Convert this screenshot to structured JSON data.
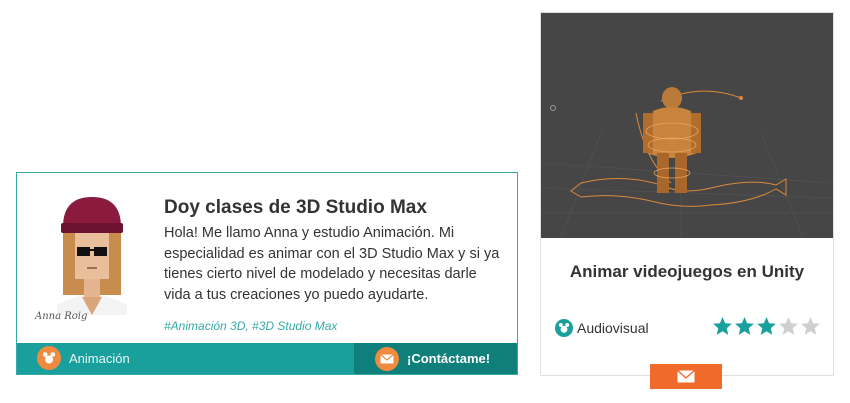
{
  "profile": {
    "author_name": "Anna Roig",
    "title": "Doy clases de 3D Studio Max",
    "description": "Hola! Me llamo Anna y estudio Animación. Mi especialidad es animar con el 3D Studio Max y si ya tienes cierto nivel de modelado y necesitas darle vida a tus creaciones yo puedo ayudarte.",
    "tags": "#Animación 3D, #3D Studio Max",
    "category": "Animación",
    "contact_label": "¡Contáctame!"
  },
  "course": {
    "title": "Animar videojuegos en Unity",
    "category": "Audiovisual",
    "rating": 3,
    "rating_max": 5
  },
  "colors": {
    "teal": "#1aa09c",
    "dark_teal": "#0e7f7b",
    "orange": "#f08a3e",
    "star_filled": "#1aa09c",
    "star_empty": "#cfcfcf"
  },
  "icons": {
    "category": "mouse-ears-icon",
    "contact": "envelope-icon"
  }
}
